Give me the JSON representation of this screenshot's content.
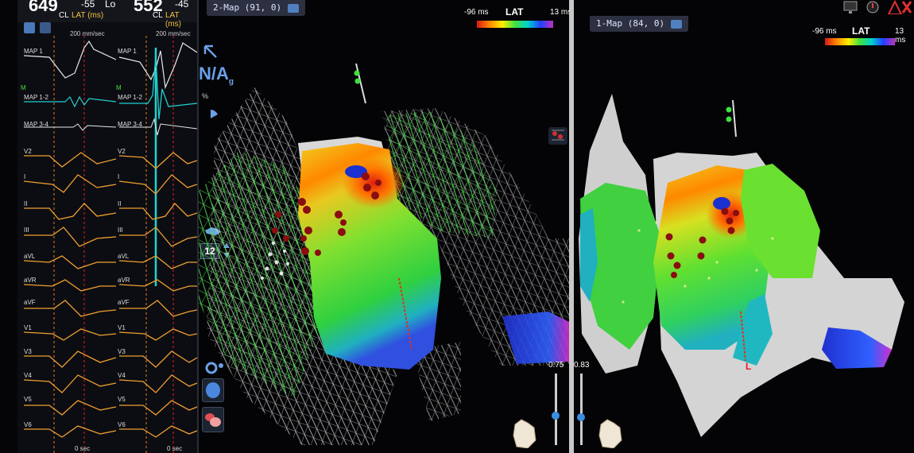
{
  "ecg_left": {
    "big_value": "649",
    "lat_value": "-55",
    "lat_suffix": "Lo",
    "cl_label": "CL",
    "lat_label": "LAT (ms)",
    "speed": "200 mm/sec",
    "channels": [
      "MAP 1",
      "M",
      "MAP 1-2",
      "MAP 3-4",
      "V2",
      "I",
      "II",
      "III",
      "aVL",
      "aVR",
      "aVF",
      "V1",
      "V3",
      "V4",
      "V5",
      "V6"
    ],
    "time_label": "0 sec"
  },
  "ecg_right": {
    "big_value": "552",
    "lat_value": "-45",
    "cl_label": "CL",
    "lat_label": "LAT (ms)",
    "speed": "200 mm/sec",
    "channels": [
      "MAP 1",
      "M",
      "MAP 1-2",
      "MAP 3-4",
      "V2",
      "I",
      "II",
      "III",
      "aVL",
      "aVR",
      "aVF",
      "V1",
      "V3",
      "V4",
      "V5",
      "V6"
    ],
    "time_label": "0 sec"
  },
  "map2": {
    "tab_label": "2-Map (91, 0)",
    "legend": {
      "min": "-96 ms",
      "title": "LAT",
      "max": "13 ms"
    },
    "opacity_value": "0.75",
    "na_label": "N/A",
    "na_sub": "g",
    "percent_label": "%",
    "zoom_value": "12"
  },
  "map1": {
    "tab_label": "1-Map (84, 0)",
    "legend": {
      "min": "-96 ms",
      "title": "LAT",
      "max": "13 ms"
    },
    "opacity_value": "0.83",
    "marker_label": "L"
  },
  "colors": {
    "ecg_trace": "#e8e8e8",
    "ecg_cyan": "#20d0d0",
    "ecg_orange": "#f0a030",
    "grid_dash": "#e08020",
    "red_dash": "#e02020",
    "wire_green": "#50e050",
    "wire_gray": "#cfcfcf",
    "lesion": "#8a0d10"
  },
  "icons": [
    "tools-icon",
    "dropdown-icon",
    "arrow-cursor-icon",
    "pie-icon",
    "grid-icon",
    "hand-icon",
    "stepper-icon",
    "gear-icon",
    "blob-icon",
    "heart-icon",
    "monitor-icon",
    "alert-icon",
    "close-icon"
  ]
}
